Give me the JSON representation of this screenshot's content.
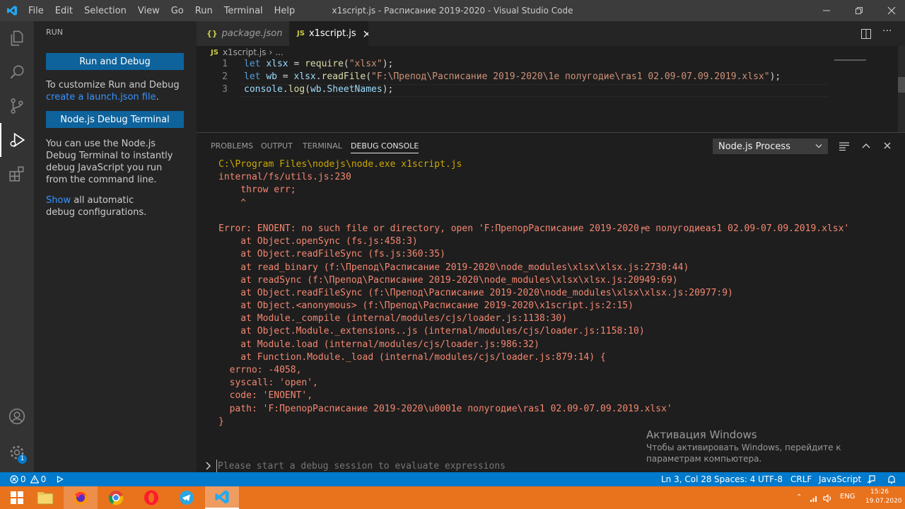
{
  "window": {
    "title": "x1script.js - Расписание 2019-2020 - Visual Studio Code",
    "menu": [
      "File",
      "Edit",
      "Selection",
      "View",
      "Go",
      "Run",
      "Terminal",
      "Help"
    ]
  },
  "sidebar": {
    "title": "RUN",
    "run_debug_button": "Run and Debug",
    "customize_text": "To customize Run and Debug",
    "create_link": "create a launch.json file",
    "create_suffix": ".",
    "node_terminal_button": "Node.js Debug Terminal",
    "node_terminal_text": "You can use the Node.js Debug Terminal to instantly debug JavaScript you run from the command line.",
    "show_link": "Show",
    "show_suffix": " all automatic debug configurations."
  },
  "tabs": [
    {
      "label": "package.json",
      "icon": "{}"
    },
    {
      "label": "x1script.js",
      "icon": "JS"
    }
  ],
  "breadcrumb": {
    "icon": "JS",
    "file": "x1script.js",
    "rest": "..."
  },
  "code": {
    "line_numbers": [
      "1",
      "2",
      "3"
    ],
    "line1": {
      "kw": "let",
      "var": "xlsx",
      "op": " = ",
      "fn": "require",
      "str": "\"xlsx\"",
      "end": ");"
    },
    "line2": {
      "kw": "let",
      "var": "wb",
      "op": " = ",
      "obj": "xlsx",
      "fn": "readFile",
      "str": "\"F:\\Препод\\Расписание 2019-2020\\1е полугодие\\ras1 02.09-07.09.2019.xlsx\"",
      "end": ");"
    },
    "line3": {
      "var": "console",
      "fn": "log",
      "arg1": "wb",
      "arg2": "SheetNames",
      "end": ");"
    }
  },
  "panel": {
    "tabs": [
      "PROBLEMS",
      "OUTPUT",
      "TERMINAL",
      "DEBUG CONSOLE"
    ],
    "process_select": "Node.js Process",
    "console_lines": [
      "C:\\Program Files\\nodejs\\node.exe x1script.js",
      "internal/fs/utils.js:230",
      "    throw err;",
      "    ^",
      "",
      "Error: ENOENT: no such file or directory, open 'F:ПрепорРасписание 2019-2020╒е полугодиеas1 02.09-07.09.2019.xlsx'",
      "    at Object.openSync (fs.js:458:3)",
      "    at Object.readFileSync (fs.js:360:35)",
      "    at read_binary (f:\\Препод\\Расписание 2019-2020\\node_modules\\xlsx\\xlsx.js:2730:44)",
      "    at readSync (f:\\Препод\\Расписание 2019-2020\\node_modules\\xlsx\\xlsx.js:20949:69)",
      "    at Object.readFileSync (f:\\Препод\\Расписание 2019-2020\\node_modules\\xlsx\\xlsx.js:20977:9)",
      "    at Object.<anonymous> (f:\\Препод\\Расписание 2019-2020\\x1script.js:2:15)",
      "    at Module._compile (internal/modules/cjs/loader.js:1138:30)",
      "    at Object.Module._extensions..js (internal/modules/cjs/loader.js:1158:10)",
      "    at Module.load (internal/modules/cjs/loader.js:986:32)",
      "    at Function.Module._load (internal/modules/cjs/loader.js:879:14) {",
      "  errno: -4058,",
      "  syscall: 'open',",
      "  code: 'ENOENT',",
      "  path: 'F:ПрепорРасписание 2019-2020\\u0001е полугодие\\ras1 02.09-07.09.2019.xlsx'",
      "}"
    ],
    "input_placeholder": "Please start a debug session to evaluate expressions"
  },
  "watermark": {
    "title": "Активация Windows",
    "text": "Чтобы активировать Windows, перейдите к параметрам компьютера."
  },
  "statusbar": {
    "errors": "0",
    "warnings": "0",
    "position": "Ln 3, Col 28",
    "spaces": "Spaces: 4",
    "encoding": "UTF-8",
    "eol": "CRLF",
    "language": "JavaScript"
  },
  "taskbar": {
    "lang": "ENG",
    "time": "15:26",
    "date": "19.07.2020"
  },
  "activity_badge": "1",
  "colors": {
    "accent": "#007acc",
    "button": "#0e639c",
    "error_text": "#f48771",
    "taskbar": "#e9721d"
  }
}
